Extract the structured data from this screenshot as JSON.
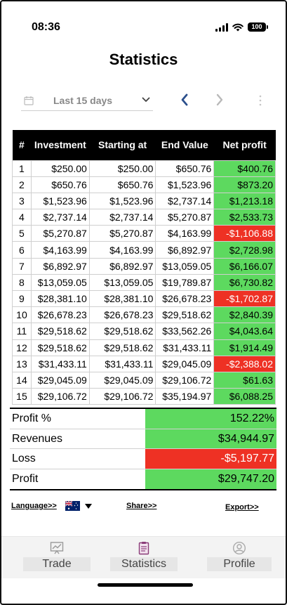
{
  "status_bar": {
    "time": "08:36",
    "battery": "100"
  },
  "page": {
    "title": "Statistics"
  },
  "filter": {
    "period": "Last 15 days"
  },
  "table": {
    "headers": [
      "#",
      "Investment",
      "Starting at",
      "End Value",
      "Net profit"
    ],
    "rows": [
      {
        "n": "1",
        "investment": "$250.00",
        "start": "$250.00",
        "end": "$650.76",
        "net": "$400.76",
        "status": "pos"
      },
      {
        "n": "2",
        "investment": "$650.76",
        "start": "$650.76",
        "end": "$1,523.96",
        "net": "$873.20",
        "status": "pos"
      },
      {
        "n": "3",
        "investment": "$1,523.96",
        "start": "$1,523.96",
        "end": "$2,737.14",
        "net": "$1,213.18",
        "status": "pos"
      },
      {
        "n": "4",
        "investment": "$2,737.14",
        "start": "$2,737.14",
        "end": "$5,270.87",
        "net": "$2,533.73",
        "status": "pos"
      },
      {
        "n": "5",
        "investment": "$5,270.87",
        "start": "$5,270.87",
        "end": "$4,163.99",
        "net": "-$1,106.88",
        "status": "neg"
      },
      {
        "n": "6",
        "investment": "$4,163.99",
        "start": "$4,163.99",
        "end": "$6,892.97",
        "net": "$2,728.98",
        "status": "pos"
      },
      {
        "n": "7",
        "investment": "$6,892.97",
        "start": "$6,892.97",
        "end": "$13,059.05",
        "net": "$6,166.07",
        "status": "pos"
      },
      {
        "n": "8",
        "investment": "$13,059.05",
        "start": "$13,059.05",
        "end": "$19,789.87",
        "net": "$6,730.82",
        "status": "pos"
      },
      {
        "n": "9",
        "investment": "$28,381.10",
        "start": "$28,381.10",
        "end": "$26,678.23",
        "net": "-$1,702.87",
        "status": "neg"
      },
      {
        "n": "10",
        "investment": "$26,678.23",
        "start": "$26,678.23",
        "end": "$29,518.62",
        "net": "$2,840.39",
        "status": "pos"
      },
      {
        "n": "11",
        "investment": "$29,518.62",
        "start": "$29,518.62",
        "end": "$33,562.26",
        "net": "$4,043.64",
        "status": "pos"
      },
      {
        "n": "12",
        "investment": "$29,518.62",
        "start": "$29,518.62",
        "end": "$31,433.11",
        "net": "$1,914.49",
        "status": "pos"
      },
      {
        "n": "13",
        "investment": "$31,433.11",
        "start": "$31,433.11",
        "end": "$29,045.09",
        "net": "-$2,388.02",
        "status": "neg"
      },
      {
        "n": "14",
        "investment": "$29,045.09",
        "start": "$29,045.09",
        "end": "$29,106.72",
        "net": "$61.63",
        "status": "pos"
      },
      {
        "n": "15",
        "investment": "$29,106.72",
        "start": "$29,106.72",
        "end": "$35,194.97",
        "net": "$6,088.25",
        "status": "pos"
      }
    ]
  },
  "summary": [
    {
      "label": "Profit %",
      "value": "152.22%",
      "status": "pos"
    },
    {
      "label": "Revenues",
      "value": "$34,944.97",
      "status": "pos"
    },
    {
      "label": "Loss",
      "value": "-$5,197.77",
      "status": "neg"
    },
    {
      "label": "Profit",
      "value": "$29,747.20",
      "status": "pos"
    }
  ],
  "links": {
    "language": "Language>>",
    "share": "Share>>",
    "export": "Export>>"
  },
  "tabs": [
    {
      "label": "Trade",
      "icon": "chart-icon"
    },
    {
      "label": "Statistics",
      "icon": "clipboard-icon"
    },
    {
      "label": "Profile",
      "icon": "user-icon"
    }
  ],
  "colors": {
    "positive": "#5dd95f",
    "negative": "#ee3124",
    "header_bg": "#000000",
    "accent": "#2b4f8c"
  }
}
